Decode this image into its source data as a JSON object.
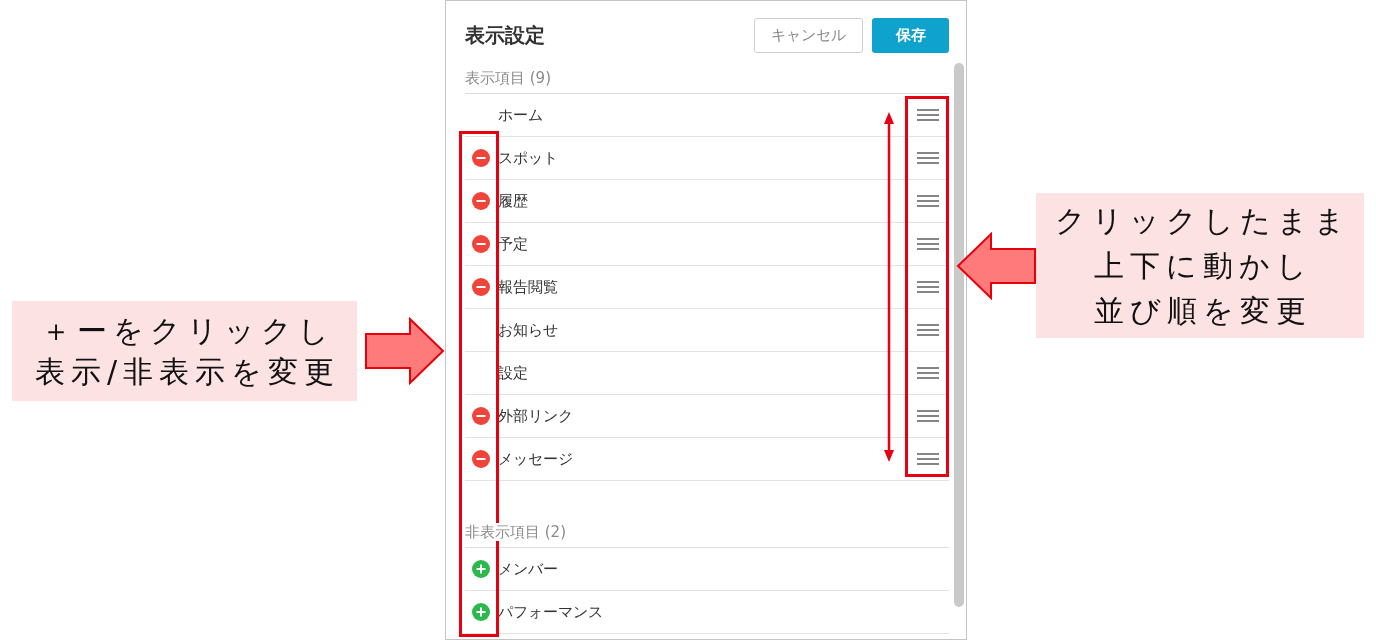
{
  "panel": {
    "title": "表示設定",
    "buttons": [
      {
        "label": "キャンセル",
        "kind": "secondary"
      },
      {
        "label": "保存",
        "kind": "primary"
      }
    ],
    "sections": [
      {
        "heading": "表示項目 (9)",
        "kind": "shown",
        "items": [
          {
            "label": "ホーム",
            "removable": false
          },
          {
            "label": "スポット",
            "removable": true
          },
          {
            "label": "履歴",
            "removable": true
          },
          {
            "label": "予定",
            "removable": true
          },
          {
            "label": "報告閲覧",
            "removable": true
          },
          {
            "label": "お知らせ",
            "removable": false
          },
          {
            "label": "設定",
            "removable": false
          },
          {
            "label": "外部リンク",
            "removable": true
          },
          {
            "label": "メッセージ",
            "removable": true
          }
        ]
      },
      {
        "heading": "非表示項目 (2)",
        "kind": "hidden",
        "items": [
          {
            "label": "メンバー"
          },
          {
            "label": "パフォーマンス"
          }
        ]
      }
    ]
  },
  "callouts": [
    {
      "lines": [
        "＋ーをクリックし",
        "表示/非表示を変更"
      ]
    },
    {
      "lines": [
        "クリックしたまま",
        "上下に動かし",
        "並び順を変更"
      ]
    }
  ]
}
